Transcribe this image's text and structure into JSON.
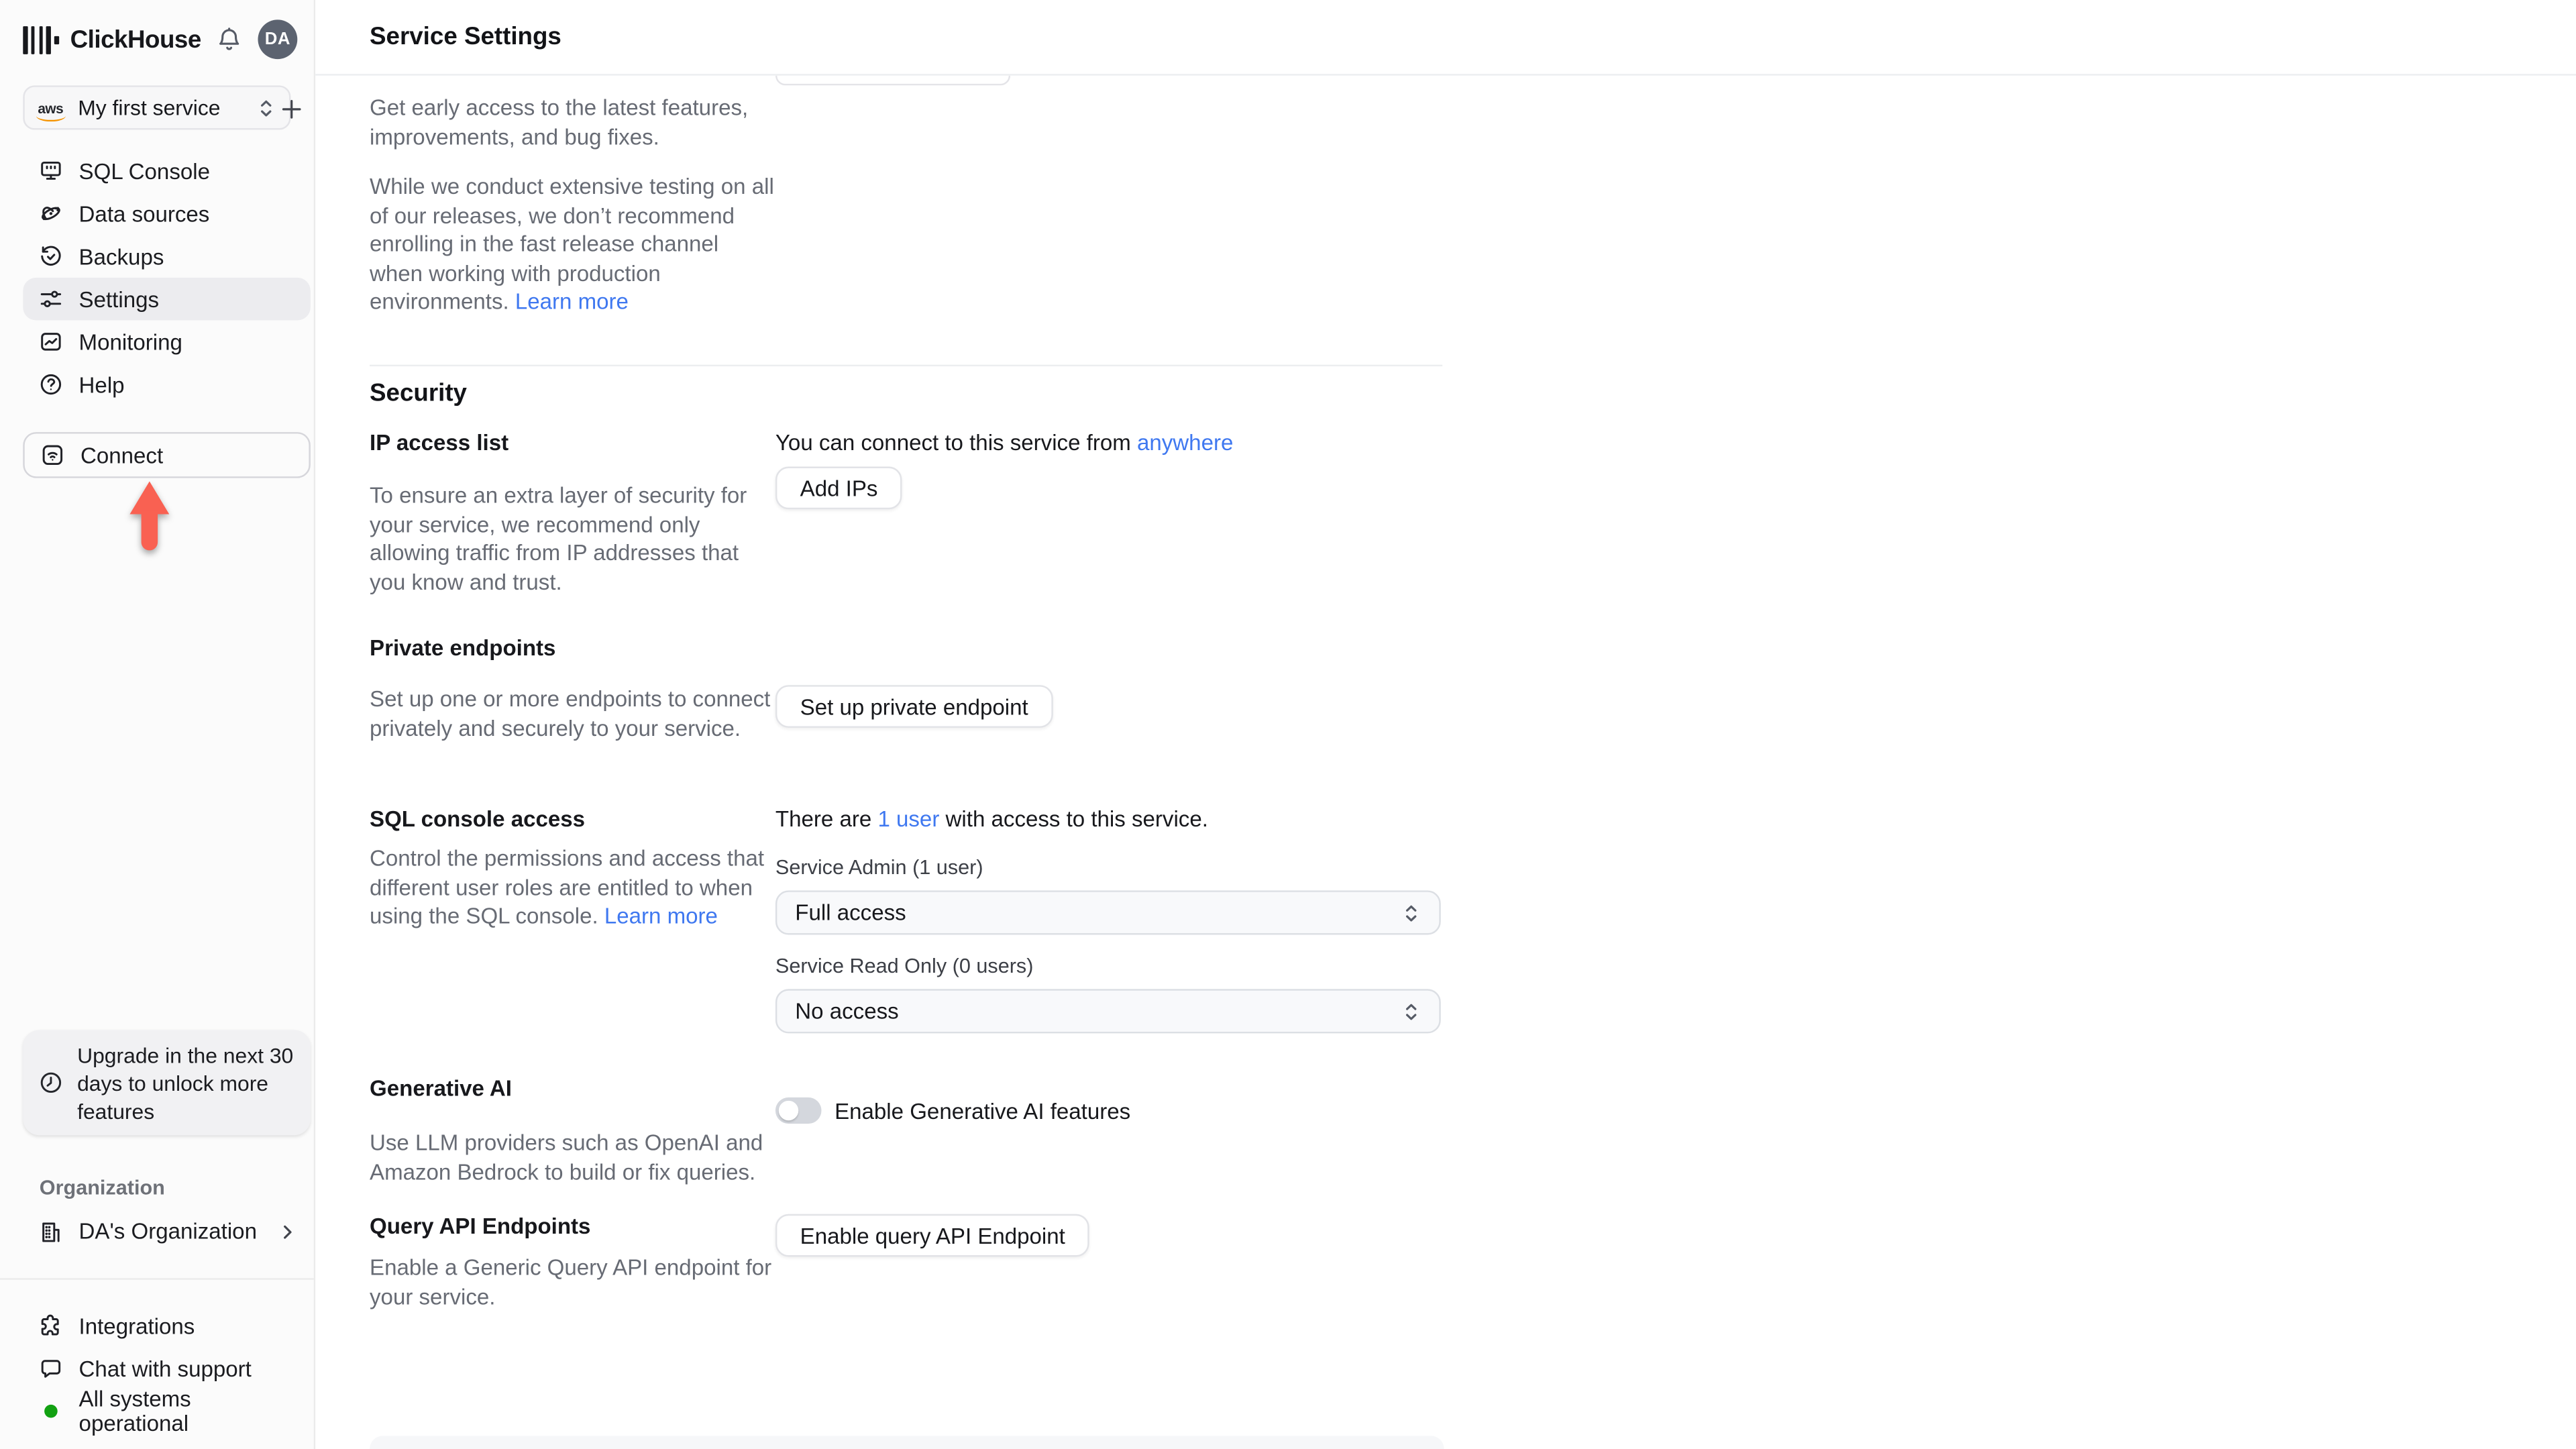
{
  "brand": {
    "name": "ClickHouse"
  },
  "topbar": {
    "avatar_initials": "DA"
  },
  "header": {
    "title": "Service Settings"
  },
  "sidebar": {
    "service_picker": {
      "provider": "aws",
      "label": "My first service"
    },
    "nav": [
      {
        "label": "SQL Console"
      },
      {
        "label": "Data sources"
      },
      {
        "label": "Backups"
      },
      {
        "label": "Settings"
      },
      {
        "label": "Monitoring"
      },
      {
        "label": "Help"
      }
    ],
    "connect": {
      "label": "Connect"
    },
    "upgrade": {
      "text": "Upgrade in the next 30 days to unlock more features"
    },
    "organization": {
      "section_label": "Organization",
      "name": "DA's Organization"
    },
    "footer": [
      {
        "label": "Integrations"
      },
      {
        "label": "Chat with support"
      },
      {
        "label": "All systems operational"
      }
    ]
  },
  "release_channel": {
    "intro": "Get early access to the latest features, improvements, and bug fixes.",
    "warning": "While we conduct extensive testing on all of our releases, we don’t recommend enrolling in the fast release channel when working with production environments. ",
    "learn_more": "Learn more"
  },
  "security": {
    "title": "Security",
    "ip_access_list": {
      "title": "IP access list",
      "description": "To ensure an extra layer of security for your service, we recommend only allowing traffic from IP addresses that you know and trust.",
      "status_prefix": "You can connect to this service from ",
      "status_link": "anywhere",
      "add_button": "Add IPs"
    },
    "private_endpoints": {
      "title": "Private endpoints",
      "description": "Set up one or more endpoints to connect privately and securely to your service.",
      "setup_button": "Set up private endpoint"
    },
    "sql_console_access": {
      "title": "SQL console access",
      "description": "Control the permissions and access that different user roles are entitled to when using the SQL console. ",
      "learn_more": "Learn more",
      "users_prefix": "There are ",
      "users_link": "1 user",
      "users_suffix": " with access to this service.",
      "service_admin_label": "Service Admin (1 user)",
      "service_admin_value": "Full access",
      "read_only_label": "Service Read Only (0 users)",
      "read_only_value": "No access"
    },
    "generative_ai": {
      "title": "Generative AI",
      "description": "Use LLM providers such as OpenAI and Amazon Bedrock to build or fix queries.",
      "toggle_label": "Enable Generative AI features",
      "toggle_state": "off"
    },
    "query_api_endpoints": {
      "title": "Query API Endpoints",
      "description": "Enable a Generic Query API endpoint for your service.",
      "enable_button": "Enable query API Endpoint"
    }
  }
}
